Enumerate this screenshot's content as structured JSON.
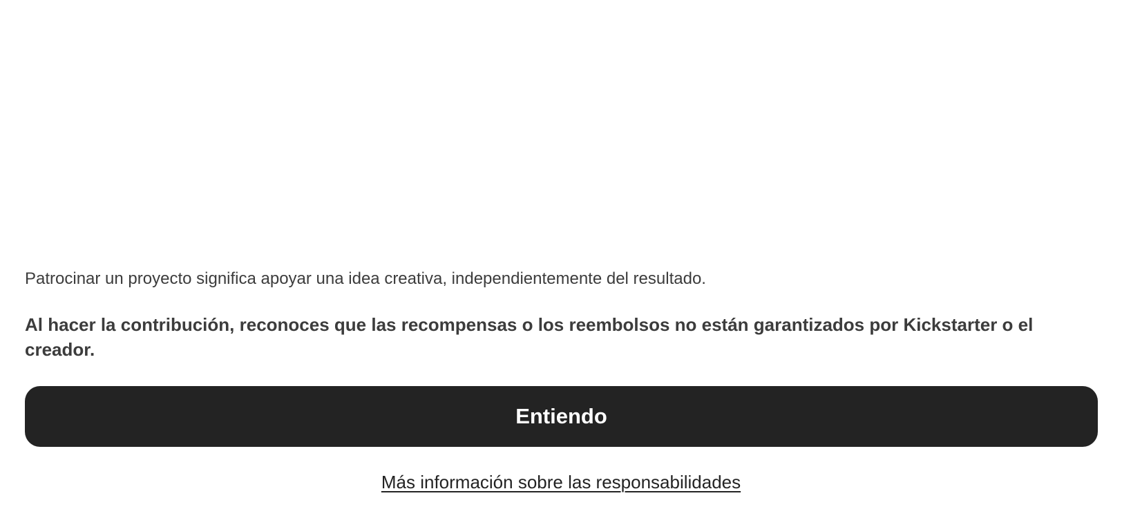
{
  "dialog": {
    "intro": "Patrocinar un proyecto significa apoyar una idea creativa, independientemente del resultado.",
    "acknowledgement": "Al hacer la contribución, reconoces que las recompensas o los reembolsos no están garantizados por Kickstarter o el creador.",
    "confirm_label": "Entiendo",
    "more_info_label": "Más información sobre las responsabilidades"
  },
  "colors": {
    "button_background": "#232323",
    "button_text": "#ffffff",
    "body_text": "#3c3c3c",
    "page_background": "#ffffff"
  }
}
